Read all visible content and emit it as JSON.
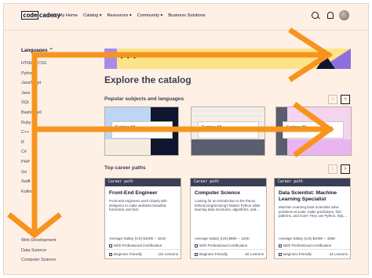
{
  "header": {
    "logo_code": "code",
    "logo_rest": "cademy",
    "nav": [
      "My Home",
      "Catalog ▾",
      "Resources ▾",
      "Community ▾",
      "Business Solutions"
    ]
  },
  "sidebar": {
    "title": "Languages ⌃",
    "items": [
      "HTML & CSS",
      "Python",
      "JavaScript",
      "Java",
      "SQL",
      "Bash/Shell",
      "Ruby",
      "C++",
      "R",
      "C#",
      "PHP",
      "Go",
      "Swift",
      "Kotlin"
    ],
    "bottom_items": [
      "Web Development",
      "Data Science",
      "Computer Science"
    ]
  },
  "main": {
    "title": "Explore the catalog",
    "popular_heading": "Popular subjects and languages",
    "career_heading": "Top career paths",
    "prev_symbol": "‹",
    "next_symbol": "›",
    "categories": [
      {
        "label": "Explore All"
      },
      {
        "label": "Explore All"
      },
      {
        "label": "Explore All"
      }
    ],
    "careers": [
      {
        "tag": "Career path",
        "title": "Front-End Engineer",
        "desc": "Front-end engineers work closely with designers to make websites beautiful, functional, and fast.",
        "salary": "Average Salary (US) $100K – 161K",
        "cert": "With Professional Certification",
        "level": "Beginner Friendly",
        "lessons": "131 Lessons"
      },
      {
        "tag": "Career path",
        "title": "Computer Science",
        "desc": "Looking for an introduction to the theory behind programming? Master Python while learning data structures, algorithms, and...",
        "salary": "Average Salary (US) $66K – 122K",
        "cert": "With Professional Certification",
        "level": "Beginner Friendly",
        "lessons": "82 Lessons"
      },
      {
        "tag": "Career path",
        "title": "Data Scientist: Machine Learning Specialist",
        "desc": "Machine Learning Data Scientists solve problems at scale, make predictions, find patterns, and more! They use Python, SQL...",
        "salary": "Average Salary (US) $109K – 156K",
        "cert": "With Professional Certification",
        "level": "Beginner Friendly",
        "lessons": "44 Lessons"
      }
    ]
  },
  "colors": {
    "background": "#fff0e5",
    "navy": "#10162f",
    "banner_yellow": "#fde488",
    "purple": "#8e6fe0",
    "overlay_arrow": "#f7941d"
  }
}
